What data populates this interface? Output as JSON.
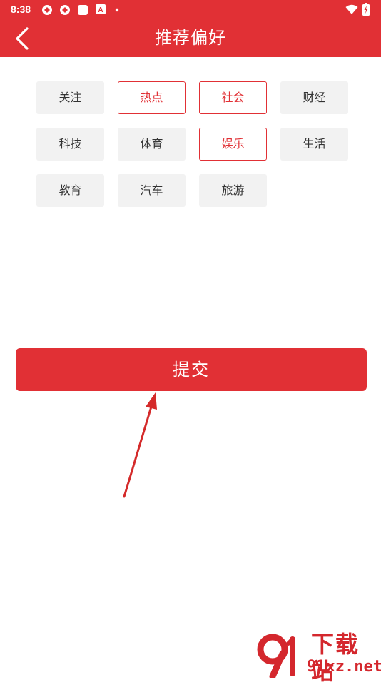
{
  "status_bar": {
    "time": "8:38",
    "icons": [
      "app-notification-icon",
      "app-notification-icon",
      "square-icon",
      "font-a-icon",
      "dot-icon",
      "wifi-icon",
      "battery-icon"
    ]
  },
  "header": {
    "title": "推荐偏好",
    "back_icon": "chevron-left-icon"
  },
  "tags": [
    {
      "label": "关注",
      "selected": false
    },
    {
      "label": "热点",
      "selected": true
    },
    {
      "label": "社会",
      "selected": true
    },
    {
      "label": "财经",
      "selected": false
    },
    {
      "label": "科技",
      "selected": false
    },
    {
      "label": "体育",
      "selected": false
    },
    {
      "label": "娱乐",
      "selected": true
    },
    {
      "label": "生活",
      "selected": false
    },
    {
      "label": "教育",
      "selected": false
    },
    {
      "label": "汽车",
      "selected": false
    },
    {
      "label": "旅游",
      "selected": false
    }
  ],
  "submit": {
    "label": "提交"
  },
  "watermark": {
    "top": "下载站",
    "bottom": "91xz.net"
  },
  "colors": {
    "brand": "#e13035",
    "tag_bg": "#f2f2f2",
    "tag_text": "#333333"
  }
}
